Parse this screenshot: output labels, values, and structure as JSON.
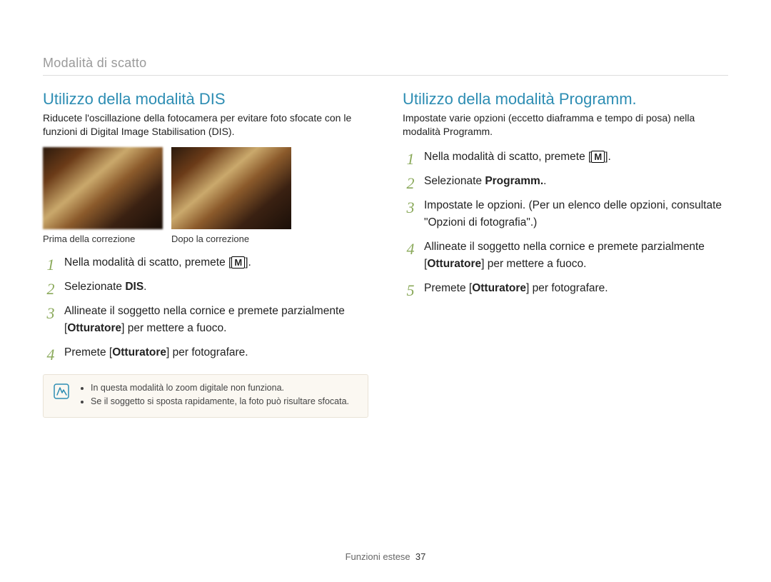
{
  "pageHeader": "Modalità di scatto",
  "footer": {
    "section": "Funzioni estese",
    "page": "37"
  },
  "left": {
    "title": "Utilizzo della modalità DIS",
    "intro": "Riducete l'oscillazione della fotocamera per evitare foto sfocate con le funzioni di Digital Image Stabilisation (DIS).",
    "img1_caption": "Prima della correzione",
    "img2_caption": "Dopo la correzione",
    "steps": {
      "s1a": "Nella modalità di scatto, premete [",
      "s1b": "].",
      "s2a": "Selezionate ",
      "s2b": "DIS",
      "s2c": ".",
      "s3a": "Allineate il soggetto nella cornice e premete parzialmente [",
      "s3b": "Otturatore",
      "s3c": "] per mettere a fuoco.",
      "s4a": "Premete [",
      "s4b": "Otturatore",
      "s4c": "] per fotografare."
    },
    "notes": {
      "n1": "In questa modalità lo zoom digitale non funziona.",
      "n2": "Se il soggetto si sposta rapidamente, la foto può risultare sfocata."
    }
  },
  "right": {
    "title": "Utilizzo della modalità Programm.",
    "intro": "Impostate varie opzioni (eccetto diaframma e tempo di posa) nella modalità Programm.",
    "steps": {
      "s1a": "Nella modalità di scatto, premete [",
      "s1b": "].",
      "s2a": "Selezionate ",
      "s2b": "Programm.",
      "s2c": ".",
      "s3": "Impostate le opzioni. (Per un elenco delle opzioni, consultate \"Opzioni di fotografia\".)",
      "s4a": "Allineate il soggetto nella cornice e premete parzialmente [",
      "s4b": "Otturatore",
      "s4c": "] per mettere a fuoco.",
      "s5a": "Premete [",
      "s5b": "Otturatore",
      "s5c": "] per fotografare."
    }
  },
  "mode_icon_letter": "M"
}
